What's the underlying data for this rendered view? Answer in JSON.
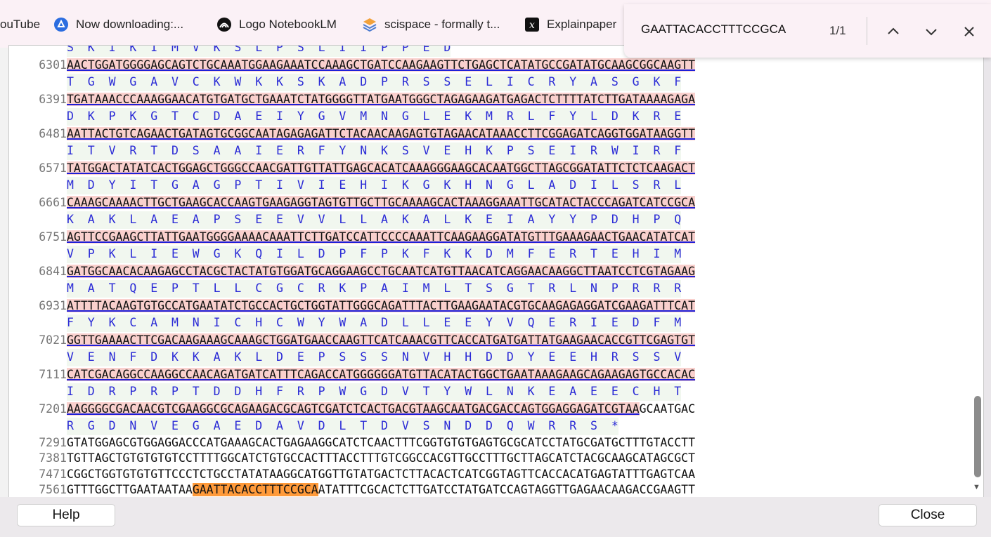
{
  "bookmarks": [
    {
      "label": "ouTube",
      "icon": "youtube-icon"
    },
    {
      "label": "Now downloading:...",
      "icon": "drive-icon"
    },
    {
      "label": "Logo NotebookLM",
      "icon": "notebooklm-icon"
    },
    {
      "label": "scispace - formally t...",
      "icon": "scispace-icon"
    },
    {
      "label": "Explainpaper",
      "icon": "explainpaper-icon"
    }
  ],
  "find": {
    "query": "GAATTACACCTTTCCGCA",
    "count": "1/1"
  },
  "top_partial": "S  K  I  K  I  M  V  K  S  L  P  S  L  I  I  P  P  E  D",
  "rows": [
    {
      "num": "6301",
      "dna": "AACTGGATGGGGAGCAGTCTGCAAATGGAAGAAATCCAAAGCTGATCCAAGAAGTTCTGAGCTCATATGCCGATATGCAAGCGGCAAGTT",
      "prot": "T  G  W  G  A  V  C  K  W  K  K  S  K  A  D  P  R  S  S  E  L  I  C  R  Y  A  S  G  K  F"
    },
    {
      "num": "6391",
      "dna": "TGATAAACCCAAAGGAACATGTGATGCTGAAATCTATGGGGTTATGAATGGGCTAGAGAAGATGAGACTCTTTTATCTTGATAAAAGAGA",
      "prot": "D  K  P  K  G  T  C  D  A  E  I  Y  G  V  M  N  G  L  E  K  M  R  L  F  Y  L  D  K  R  E"
    },
    {
      "num": "6481",
      "dna": "AATTACTGTCAGAACTGATAGTGCGGCAATAGAGAGATTCTACAACAAGAGTGTAGAACATAAACCTTCGGAGATCAGGTGGATAAGGTT",
      "prot": "I  T  V  R  T  D  S  A  A  I  E  R  F  Y  N  K  S  V  E  H  K  P  S  E  I  R  W  I  R  F"
    },
    {
      "num": "6571",
      "dna": "TATGGACTATATCACTGGAGCTGGGCCAACGATTGTTATTGAGCACATCAAAGGGAAGCACAATGGCTTAGCGGATATTCTCTCAAGACT",
      "prot": "M  D  Y  I  T  G  A  G  P  T  I  V  I  E  H  I  K  G  K  H  N  G  L  A  D  I  L  S  R  L"
    },
    {
      "num": "6661",
      "dna": "CAAAGCAAAACTTGCTGAAGCACCAAGTGAAGAGGTAGTGTTGCTTGCAAAAGCACTAAAGGAAATTGCATACTACCCAGATCATCCGCA",
      "prot": "K  A  K  L  A  E  A  P  S  E  E  V  V  L  L  A  K  A  L  K  E  I  A  Y  Y  P  D  H  P  Q"
    },
    {
      "num": "6751",
      "dna": "AGTTCCGAAGCTTATTGAATGGGGAAAACAAATTCTTGATCCATTCCCCAAATTCAAGAAGGATATGTTTGAAAGAACTGAACATATCAT",
      "prot": "V  P  K  L  I  E  W  G  K  Q  I  L  D  P  F  P  K  F  K  K  D  M  F  E  R  T  E  H  I  M"
    },
    {
      "num": "6841",
      "dna": "GATGGCAACACAAGAGCCTACGCTACTATGTGGATGCAGGAAGCCTGCAATCATGTTAACATCAGGAACAAGGCTTAATCCTCGTAGAAG",
      "prot": "M  A  T  Q  E  P  T  L  L  C  G  C  R  K  P  A  I  M  L  T  S  G  T  R  L  N  P  R  R  R"
    },
    {
      "num": "6931",
      "dna": "ATTTTACAAGTGTGCCATGAATATCTGCCACTGCTGGTATTGGGCAGATTTACTTGAAGAATACGTGCAAGAGAGGATCGAAGATTTCAT",
      "prot": "F  Y  K  C  A  M  N  I  C  H  C  W  Y  W  A  D  L  L  E  E  Y  V  Q  E  R  I  E  D  F  M"
    },
    {
      "num": "7021",
      "dna": "GGTTGAAAACTTCGACAAGAAAGCAAAGCTGGATGAACCAAGTTCATCAAACGTTCACCATGATGATTATGAAGAACACCGTTCGAGTGT",
      "prot": "V  E  N  F  D  K  K  A  K  L  D  E  P  S  S  S  N  V  H  H  D  D  Y  E  E  H  R  S  S  V"
    },
    {
      "num": "7111",
      "dna": "CATCGACAGGCCAAGGCCAACAGATGATCATTTCAGACCATGGGGGGATGTTACATACTGGCTGAATAAAGAAGCAGAAGAGTGCCACAC",
      "prot": "I  D  R  P  R  P  T  D  D  H  F  R  P  W  G  D  V  T  Y  W  L  N  K  E  A  E  E  C  H  T"
    },
    {
      "num": "7201",
      "dna": "AAGGGGCGACAACGTCGAAGGCGCAGAAGACGCAGTCGATCTCACTGACGTAAGCAATGACGACCAGTGGAGGAGATCGTAA",
      "tail": "GCAATGAC",
      "prot": "R  G  D  N  V  E  G  A  E  D  A  V  D  L  T  D  V  S  N  D  D  Q  W  R  R  S  *"
    }
  ],
  "plain_rows": [
    {
      "num": "7291",
      "seq": "GTATGGAGCGTGGAGGACCCATGAAAGCACTGAGAAGGCATCTCAACTTTCGGTGTGTGAGTGCGCATCCTATGCGATGCTTTGTACCTT"
    },
    {
      "num": "7381",
      "seq": "TGTTAGCTGTGTGTGTCCTTTTGGCATCTGTGCCACTTTACCTTTGTCGGCCACGTTGCCTTTGCTTAGCATCTACGCAAGCATAGCGCT"
    },
    {
      "num": "7471",
      "seq": "CGGCTGGTGTGTGTTCCCTCTGCCTATATAAGGCATGGTTGTATGACTCTTACACTCATCGGTAGTTCACCACATGAGTATTTGAGTCAA"
    },
    {
      "num": "7561",
      "pre": "GTTTGGCTTGAATAATAA",
      "match": "GAATTACACCTTTCCGCA",
      "post": "ATATTTCGCACTCTTGATCCTATGATCCAGTAGGTTGAGAACAAGACCGAAGTT"
    }
  ],
  "buttons": {
    "help": "Help",
    "close": "Close"
  },
  "colors": {
    "dna_bg": "#f9d0cd",
    "protein_bg": "#f1f7ef",
    "protein_text": "#2a2ad6",
    "match_highlight": "#ff9a3a"
  }
}
